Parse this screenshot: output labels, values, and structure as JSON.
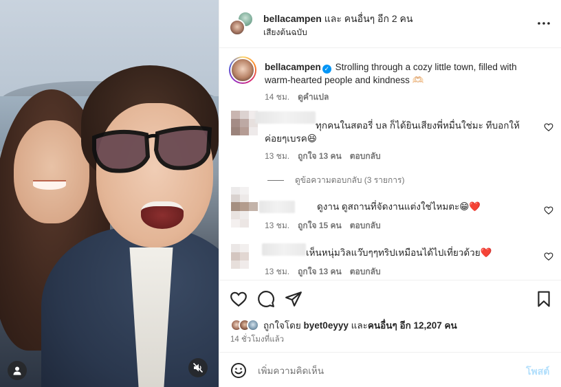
{
  "header": {
    "username": "bellacampen",
    "others_text": "และ คนอื่นๆ อีก 2 คน",
    "audio_label": "เสียงต้นฉบับ",
    "more_icon": "more-horizontal-icon"
  },
  "caption": {
    "username": "bellacampen",
    "verified_icon": "verified-badge-icon",
    "text": "Strolling through a cozy little town, filled with warm-hearted people and kindness 🫶🏻",
    "time": "14 ชม.",
    "translate": "ดูคำแปล"
  },
  "comments": [
    {
      "text": "ทุกคนในสตอรี่ บล ก็ได้ยินเสียงพี่หมื่นใช่มะ ทีบอกให้ค่อยๆเบรค😆",
      "time": "13 ชม.",
      "likes": "ถูกใจ 13 คน",
      "reply": "ตอบกลับ"
    },
    {
      "text": "ดูงาน ดูสถานที่จัดงานแต่งใช่ไหมตะ😁❤️",
      "time": "13 ชม.",
      "likes": "ถูกใจ 15 คน",
      "reply": "ตอบกลับ"
    },
    {
      "text": "เห็นหนุ่มวิลแว๊บๆๆทริปเหมือนได้ไปเที่ยวด้วย❤️",
      "time": "13 ชม.",
      "likes": "ถูกใจ 13 คน",
      "reply": "ตอบกลับ"
    }
  ],
  "view_replies": "ดูข้อความตอบกลับ (3 รายการ)",
  "actions": {
    "like_icon": "heart-icon",
    "comment_icon": "comment-icon",
    "share_icon": "send-icon",
    "save_icon": "bookmark-icon"
  },
  "likes": {
    "prefix": "ถูกใจโดย",
    "user": "byet0eyyy",
    "middle": "และ",
    "others": "คนอื่นๆ อีก 12,207 คน"
  },
  "posted_ago": "14 ชั่วโมงที่แล้ว",
  "add_comment": {
    "placeholder": "เพิ่มความคิดเห็น",
    "post_label": "โพสต์",
    "emoji_icon": "emoji-icon"
  },
  "media": {
    "user_tag_icon": "user-icon",
    "mute_icon": "muted-speaker-icon"
  },
  "colors": {
    "verified": "#0095f6",
    "post_disabled": "#b2dffc",
    "heart_red": "#ed4956",
    "secondary_text": "#737373"
  }
}
